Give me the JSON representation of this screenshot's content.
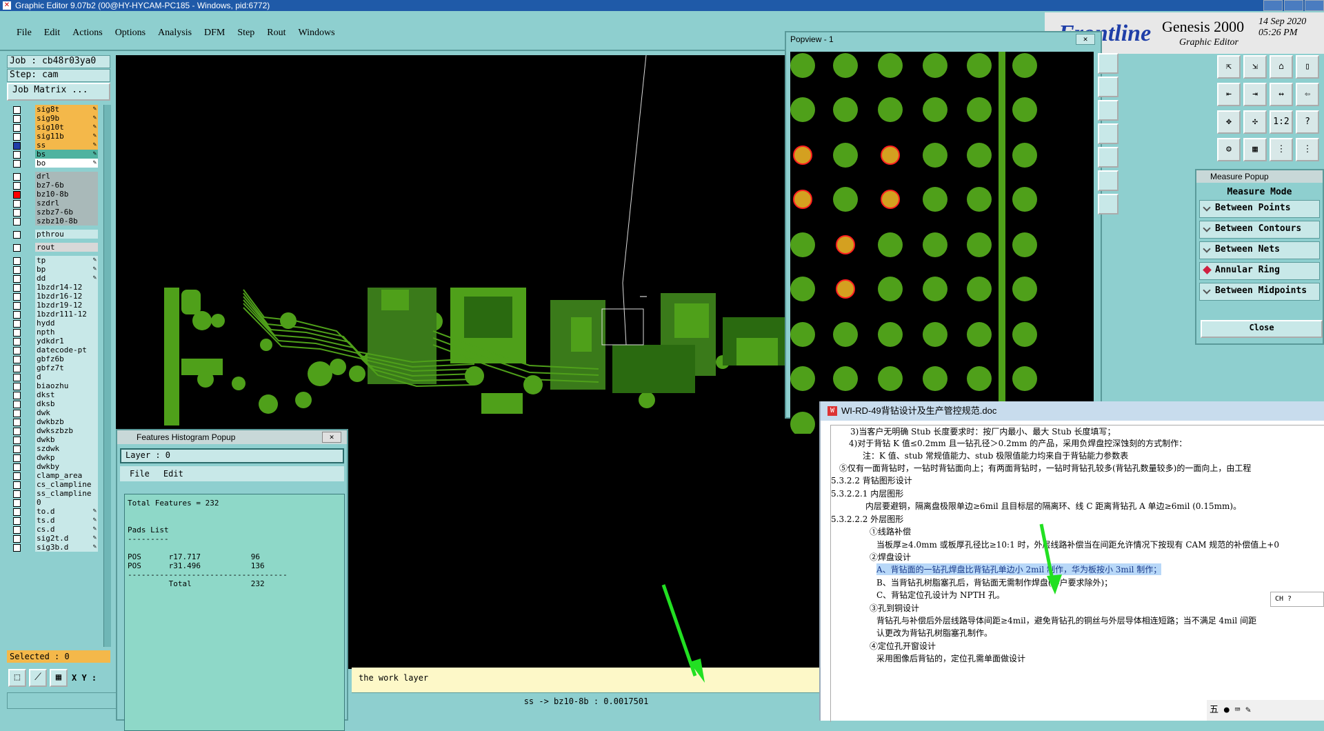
{
  "title": "Graphic Editor 9.07b2 (00@HY-HYCAM-PC185 - Windows, pid:6772)",
  "menu": [
    "File",
    "Edit",
    "Actions",
    "Options",
    "Analysis",
    "DFM",
    "Step",
    "Rout",
    "Windows"
  ],
  "logo": {
    "brand": "Frontline",
    "product": "Genesis 2000",
    "subtitle": "Graphic Editor",
    "date": "14 Sep 2020",
    "time": "05:26 PM"
  },
  "job": {
    "job": "Job : cb48r03ya0",
    "step": "Step: cam",
    "matrix": "Job Matrix ..."
  },
  "layers": [
    {
      "name": "sig8t",
      "color": "#f4b84a",
      "mark": "✎",
      "sel": false
    },
    {
      "name": "sig9b",
      "color": "#f4b84a",
      "mark": "✎",
      "sel": false
    },
    {
      "name": "sig10t",
      "color": "#f4b84a",
      "mark": "✎",
      "sel": false
    },
    {
      "name": "sig11b",
      "color": "#f4b84a",
      "mark": "✎",
      "sel": false
    },
    {
      "name": "ss",
      "color": "#f4b84a",
      "mark": "✎",
      "sel": true
    },
    {
      "name": "bs",
      "color": "#4fb3a0",
      "mark": "✎",
      "sel": false
    },
    {
      "name": "bo",
      "color": "#ffffff",
      "mark": "✎",
      "sel": false
    },
    {
      "name": "drl",
      "color": "#a9b9b9",
      "mark": "",
      "sel": false
    },
    {
      "name": "bz7-6b",
      "color": "#a9b9b9",
      "mark": "",
      "sel": false
    },
    {
      "name": "bz10-8b",
      "color": "#a9b9b9",
      "mark": "",
      "sel": false,
      "red": true
    },
    {
      "name": "szdrl",
      "color": "#a9b9b9",
      "mark": "",
      "sel": false
    },
    {
      "name": "szbz7-6b",
      "color": "#a9b9b9",
      "mark": "",
      "sel": false
    },
    {
      "name": "szbz10-8b",
      "color": "#a9b9b9",
      "mark": "",
      "sel": false
    },
    {
      "name": "pthrou",
      "color": "#c8e8e8",
      "mark": "",
      "sel": false
    },
    {
      "name": "rout",
      "color": "#d8d8d8",
      "mark": "",
      "sel": false
    },
    {
      "name": "tp",
      "color": "#c8e8e8",
      "mark": "✎",
      "sel": false
    },
    {
      "name": "bp",
      "color": "#c8e8e8",
      "mark": "✎",
      "sel": false
    },
    {
      "name": "dd",
      "color": "#c8e8e8",
      "mark": "✎",
      "sel": false
    },
    {
      "name": "1bzdr14-12",
      "color": "#c8e8e8",
      "mark": "",
      "sel": false
    },
    {
      "name": "1bzdr16-12",
      "color": "#c8e8e8",
      "mark": "",
      "sel": false
    },
    {
      "name": "1bzdr19-12",
      "color": "#c8e8e8",
      "mark": "",
      "sel": false
    },
    {
      "name": "1bzdr111-12",
      "color": "#c8e8e8",
      "mark": "",
      "sel": false
    },
    {
      "name": "hydd",
      "color": "#c8e8e8",
      "mark": "",
      "sel": false
    },
    {
      "name": "npth",
      "color": "#c8e8e8",
      "mark": "",
      "sel": false
    },
    {
      "name": "ydkdr1",
      "color": "#c8e8e8",
      "mark": "",
      "sel": false
    },
    {
      "name": "datecode-pt",
      "color": "#c8e8e8",
      "mark": "",
      "sel": false
    },
    {
      "name": "gbfz6b",
      "color": "#c8e8e8",
      "mark": "",
      "sel": false
    },
    {
      "name": "gbfz7t",
      "color": "#c8e8e8",
      "mark": "",
      "sel": false
    },
    {
      "name": "d",
      "color": "#c8e8e8",
      "mark": "",
      "sel": false
    },
    {
      "name": "biaozhu",
      "color": "#c8e8e8",
      "mark": "",
      "sel": false
    },
    {
      "name": "dkst",
      "color": "#c8e8e8",
      "mark": "",
      "sel": false
    },
    {
      "name": "dksb",
      "color": "#c8e8e8",
      "mark": "",
      "sel": false
    },
    {
      "name": "dwk",
      "color": "#c8e8e8",
      "mark": "",
      "sel": false
    },
    {
      "name": "dwkbzb",
      "color": "#c8e8e8",
      "mark": "",
      "sel": false
    },
    {
      "name": "dwkszbzb",
      "color": "#c8e8e8",
      "mark": "",
      "sel": false
    },
    {
      "name": "dwkb",
      "color": "#c8e8e8",
      "mark": "",
      "sel": false
    },
    {
      "name": "szdwk",
      "color": "#c8e8e8",
      "mark": "",
      "sel": false
    },
    {
      "name": "dwkp",
      "color": "#c8e8e8",
      "mark": "",
      "sel": false
    },
    {
      "name": "dwkby",
      "color": "#c8e8e8",
      "mark": "",
      "sel": false
    },
    {
      "name": "clamp_area",
      "color": "#c8e8e8",
      "mark": "",
      "sel": false
    },
    {
      "name": "cs_clampline",
      "color": "#c8e8e8",
      "mark": "",
      "sel": false
    },
    {
      "name": "ss_clampline",
      "color": "#c8e8e8",
      "mark": "",
      "sel": false
    },
    {
      "name": "0",
      "color": "#c8e8e8",
      "mark": "",
      "sel": false
    },
    {
      "name": "to.d",
      "color": "#c8e8e8",
      "mark": "✎",
      "sel": false
    },
    {
      "name": "ts.d",
      "color": "#c8e8e8",
      "mark": "✎",
      "sel": false
    },
    {
      "name": "cs.d",
      "color": "#c8e8e8",
      "mark": "✎",
      "sel": false
    },
    {
      "name": "sig2t.d",
      "color": "#c8e8e8",
      "mark": "✎",
      "sel": false
    },
    {
      "name": "sig3b.d",
      "color": "#c8e8e8",
      "mark": "✎",
      "sel": false
    }
  ],
  "selected": "Selected : 0",
  "xy_label": "X Y :",
  "status": {
    "message": "the work layer",
    "bottom": "ss -> bz10-8b : 0.0017501"
  },
  "popview": {
    "title": "Popview - 1",
    "close": "✕"
  },
  "measure": {
    "title": "Measure Popup",
    "mode": "Measure Mode",
    "options": [
      "Between Points",
      "Between Contours",
      "Between Nets",
      "Annular Ring",
      "Between Midpoints"
    ],
    "active": "Annular Ring",
    "close": "Close"
  },
  "histogram": {
    "title": "Features Histogram Popup",
    "layer": "Layer :  0",
    "menu": [
      "File",
      "Edit"
    ],
    "text": "Total Features = 232\n\n\nPads List\n---------\n\nPOS      r17.717           96\nPOS      r31.496           136\n-----------------------------------\n         Total             232"
  },
  "doc": {
    "title": "WI-RD-49背钻设计及生产管控规范.doc",
    "lines": [
      "3)当客户无明确 Stub 长度要求时：按厂内最小、最大 Stub 长度填写；",
      "4)对于背钻 K 值≤0.2mm 且一钻孔径＞0.2mm 的产品，采用负焊盘控深蚀刻的方式制作：",
      "注：K 值、stub 常规值能力、stub 极限值能力均来自于背钻能力参数表",
      "⑤仅有一面背钻时，一钻时背钻面向上；有两面背钻时，一钻时背钻孔较多(背钻孔数量较多)的一面向上，由工程",
      "5.3.2.2 背钻图形设计",
      "5.3.2.2.1 内层图形",
      "内层要避铜，隔离盘极限单边≥6mil 且目标层的隔离环、线 C 距离背钻孔 A 单边≥6mil (0.15mm)。",
      "5.3.2.2.2 外层图形",
      "①线路补偿",
      "当板厚≥4.0mm 或板厚孔径比≥10:1 时，外层线路补偿当在间距允许情况下按现有 CAM 规范的补偿值上+0",
      "②焊盘设计",
      "A、背钻面的一钻孔焊盘比背钻孔单边小 2mil 制作，华为板按小 3mil 制作；",
      "B、当背钻孔树脂塞孔后，背钻面无需制作焊盘(客户要求除外)；",
      "C、背钻定位孔设计为 NPTH 孔。",
      "③孔到铜设计",
      "背钻孔与补偿后外层线路导体间距≥4mil，避免背钻孔的铜丝与外层导体相连短路；当不满足 4mil 间距",
      "认更改为背钻孔树脂塞孔制作。",
      "④定位孔开窗设计",
      "采用图像后背钻的，定位孔需单面做设计"
    ]
  },
  "ime": "CH ?",
  "taskbar": "五 ● ⌨ ✎",
  "colors": {
    "pad_green": "#4fa01a",
    "pad_orange": "#d4a020",
    "pad_ring": "#ff2020",
    "bg_teal": "#8ecfcf",
    "arrow": "#22e022"
  },
  "icons": [
    "app-icon",
    "pencil-icon",
    "checkbox-icon",
    "zoom-icon",
    "grid-icon",
    "arrow-icon"
  ]
}
